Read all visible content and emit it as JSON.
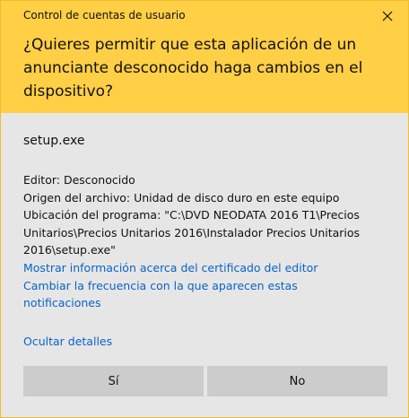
{
  "window": {
    "title": "Control de cuentas de usuario",
    "close_icon": "close-icon"
  },
  "prompt": {
    "question": "¿Quieres permitir que esta aplicación de un anunciante desconocido haga cambios en el dispositivo?"
  },
  "app": {
    "name": "setup.exe"
  },
  "details": {
    "publisher": "Editor: Desconocido",
    "file_origin": "Origen del archivo: Unidad de disco duro en este equipo",
    "program_location_lines": [
      "Ubicación del programa: \"C:\\DVD NEODATA 2016 T1\\Precios",
      "Unitarios\\Precios Unitarios 2016\\Instalador Precios Unitarios",
      "2016\\setup.exe\""
    ],
    "certificate_link": "Mostrar información acerca del certificado del editor",
    "notification_link_lines": [
      "Cambiar la frecuencia con la que aparecen estas",
      "notificaciones"
    ],
    "hide_details": "Ocultar detalles"
  },
  "buttons": {
    "yes": "Sí",
    "no": "No"
  },
  "colors": {
    "header": "#ffcf46",
    "body": "#e6e6e6",
    "link": "#0a63c8",
    "button": "#cccccc"
  }
}
